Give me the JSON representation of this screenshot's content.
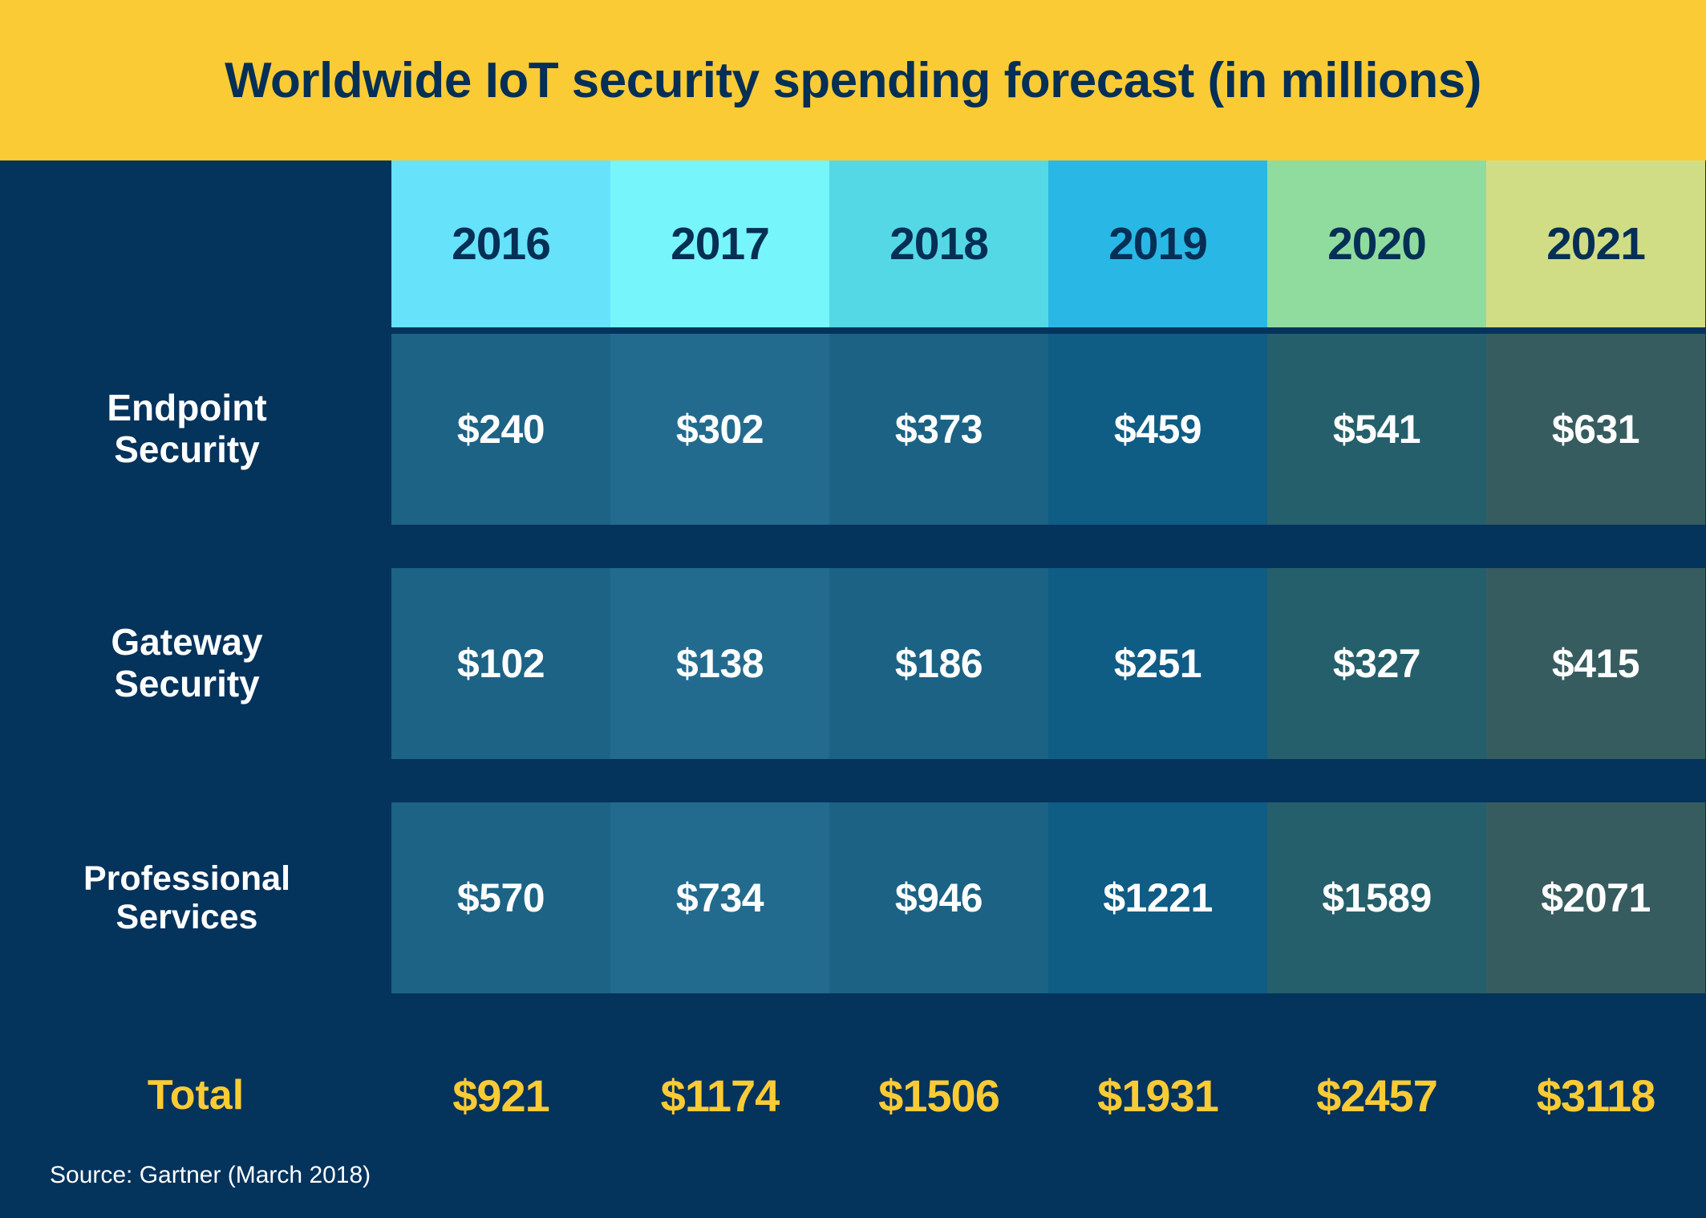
{
  "title": "Worldwide IoT security spending forecast (in millions)",
  "source": "Source: Gartner (March 2018)",
  "colors": {
    "background": "#04335c",
    "banner": "#fbcb35",
    "title_text": "#042f56",
    "total_text": "#fbcb35",
    "cell_text": "#ffffff",
    "header_text": "#052f55"
  },
  "chart_data": {
    "type": "table",
    "title": "Worldwide IoT security spending forecast (in millions)",
    "xlabel": "",
    "ylabel": "",
    "categories": [
      "2016",
      "2017",
      "2018",
      "2019",
      "2020",
      "2021"
    ],
    "series": [
      {
        "name": "Endpoint Security",
        "values": [
          240,
          302,
          373,
          459,
          541,
          631
        ]
      },
      {
        "name": "Gateway Security",
        "values": [
          102,
          138,
          186,
          251,
          327,
          415
        ]
      },
      {
        "name": "Professional Services",
        "values": [
          570,
          734,
          946,
          1221,
          1589,
          2071
        ]
      },
      {
        "name": "Total",
        "values": [
          921,
          1174,
          1506,
          1931,
          2457,
          3118
        ]
      }
    ],
    "units": "millions USD",
    "source": "Gartner (March 2018)"
  },
  "header": {
    "row_label": "",
    "years": [
      {
        "label": "2016",
        "color": "#66e2fb"
      },
      {
        "label": "2017",
        "color": "#76f5fb"
      },
      {
        "label": "2018",
        "color": "#55d8e5"
      },
      {
        "label": "2019",
        "color": "#29b8e5"
      },
      {
        "label": "2020",
        "color": "#90dc9e"
      },
      {
        "label": "2021",
        "color": "#d1dd85"
      }
    ]
  },
  "column_cell_colors": [
    "#1c6386",
    "#236b8e",
    "#1b6285",
    "#0f5c85",
    "#255f6b",
    "#375c5f"
  ],
  "rows": [
    {
      "label_line1": "Endpoint",
      "label_line2": "Security",
      "values": [
        "$240",
        "$302",
        "$373",
        "$459",
        "$541",
        "$631"
      ]
    },
    {
      "label_line1": "Gateway",
      "label_line2": "Security",
      "values": [
        "$102",
        "$138",
        "$186",
        "$251",
        "$327",
        "$415"
      ]
    },
    {
      "label_line1": "Professional",
      "label_line2": "Services",
      "values": [
        "$570",
        "$734",
        "$946",
        "$1221",
        "$1589",
        "$2071"
      ]
    }
  ],
  "total": {
    "label": "Total",
    "values": [
      "$921",
      "$1174",
      "$1506",
      "$1931",
      "$2457",
      "$3118"
    ]
  }
}
